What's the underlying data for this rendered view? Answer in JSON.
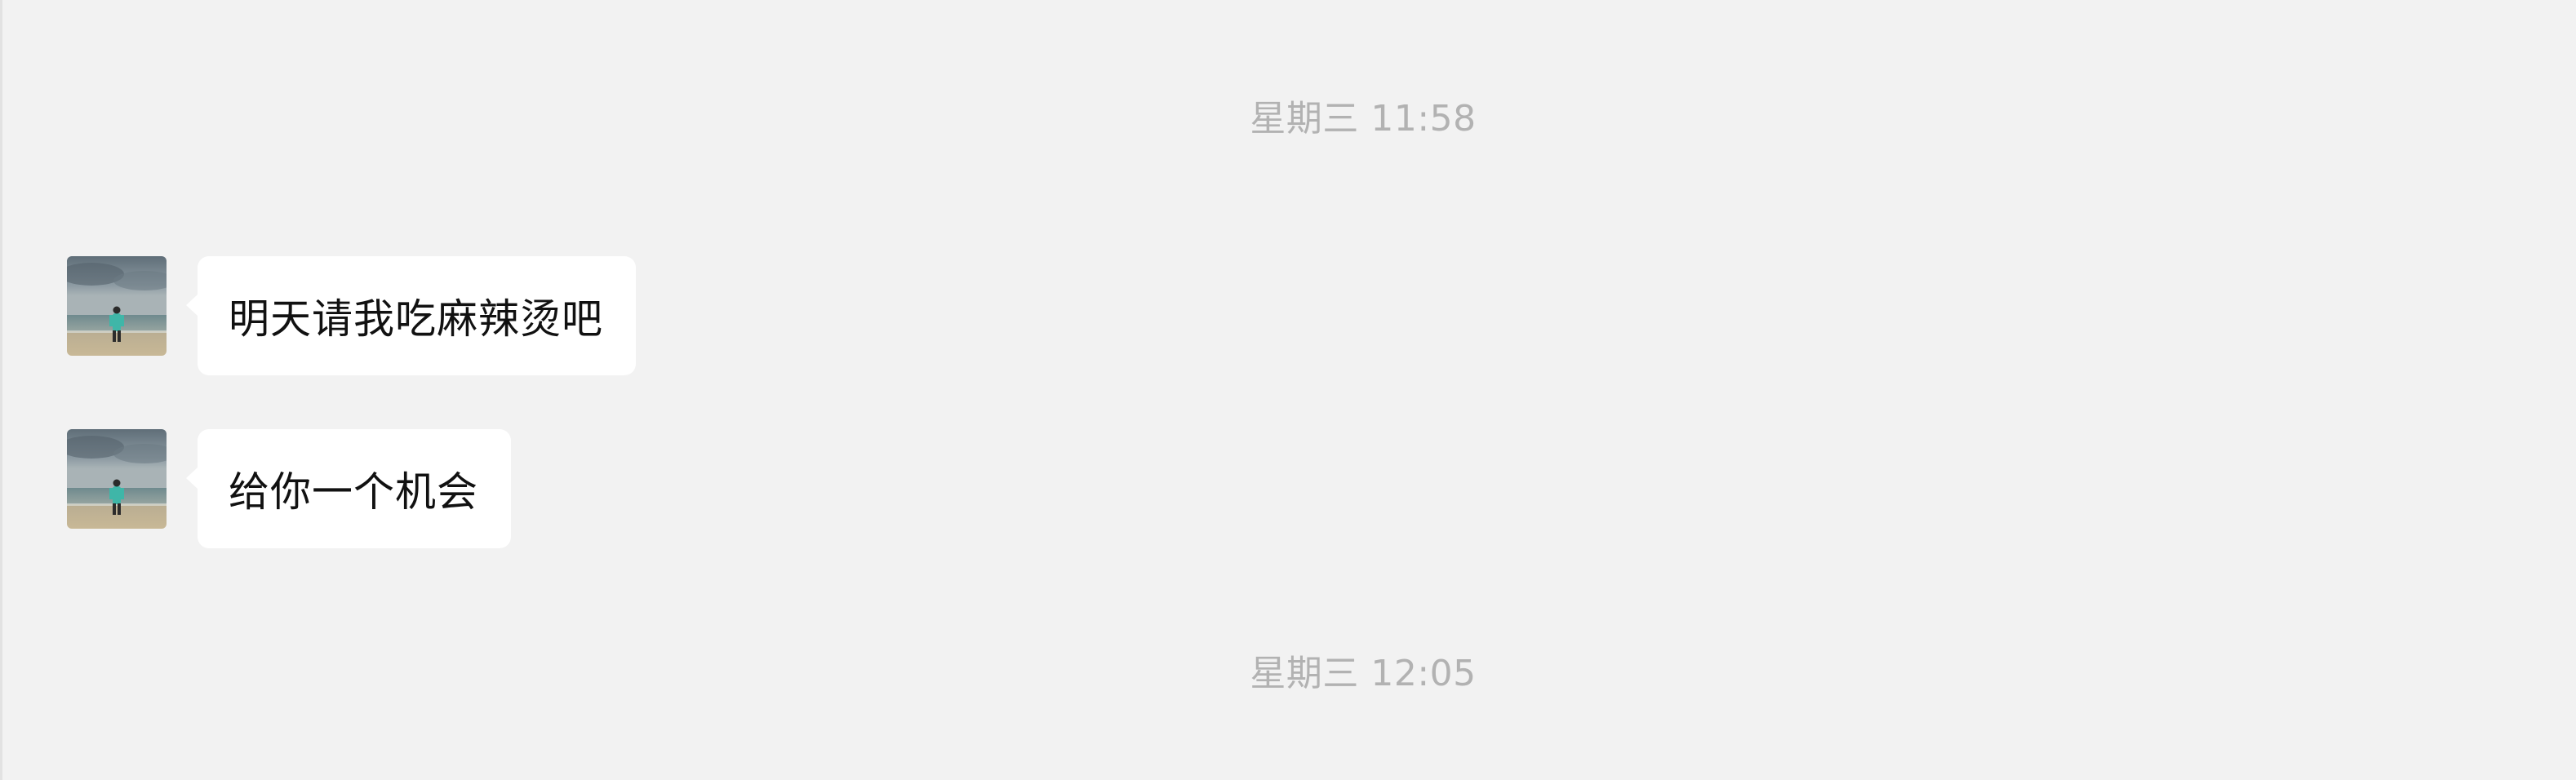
{
  "chat": {
    "timestamps": [
      "星期三 11:58",
      "星期三 12:05"
    ],
    "messages": [
      {
        "sender": "other",
        "avatar_icon": "avatar-beach-photo",
        "text": "明天请我吃麻辣烫吧"
      },
      {
        "sender": "other",
        "avatar_icon": "avatar-beach-photo",
        "text": "给你一个机会"
      }
    ]
  },
  "colors": {
    "background": "#f2f2f2",
    "bubble": "#ffffff",
    "timestamp_text": "#b2b2b2",
    "message_text": "#111111"
  }
}
